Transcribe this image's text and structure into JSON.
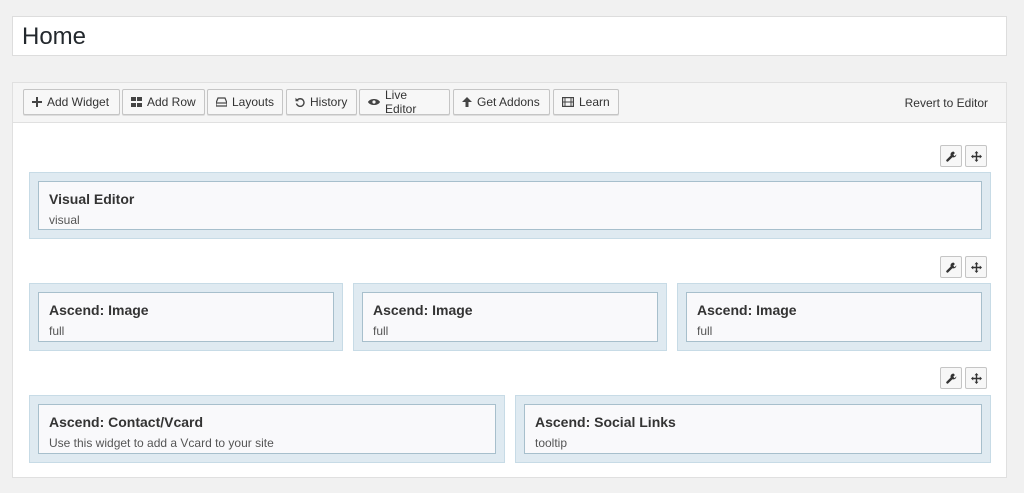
{
  "page": {
    "title": "Home"
  },
  "toolbar": {
    "buttons": [
      {
        "label": "Add Widget",
        "icon": "plus-icon"
      },
      {
        "label": "Add Row",
        "icon": "grid-icon"
      },
      {
        "label": "Layouts",
        "icon": "layouts-icon"
      },
      {
        "label": "History",
        "icon": "undo-icon"
      },
      {
        "label": "Live Editor",
        "icon": "eye-icon"
      },
      {
        "label": "Get Addons",
        "icon": "arrow-up-icon"
      },
      {
        "label": "Learn",
        "icon": "film-icon"
      }
    ],
    "revert_label": "Revert to Editor"
  },
  "rows": [
    {
      "widgets": [
        {
          "title": "Visual Editor",
          "desc": "visual"
        }
      ]
    },
    {
      "widgets": [
        {
          "title": "Ascend: Image",
          "desc": "full"
        },
        {
          "title": "Ascend: Image",
          "desc": "full"
        },
        {
          "title": "Ascend: Image",
          "desc": "full"
        }
      ]
    },
    {
      "widgets": [
        {
          "title": "Ascend: Contact/Vcard",
          "desc": "Use this widget to add a Vcard to your site"
        },
        {
          "title": "Ascend: Social Links",
          "desc": "tooltip"
        }
      ]
    }
  ]
}
